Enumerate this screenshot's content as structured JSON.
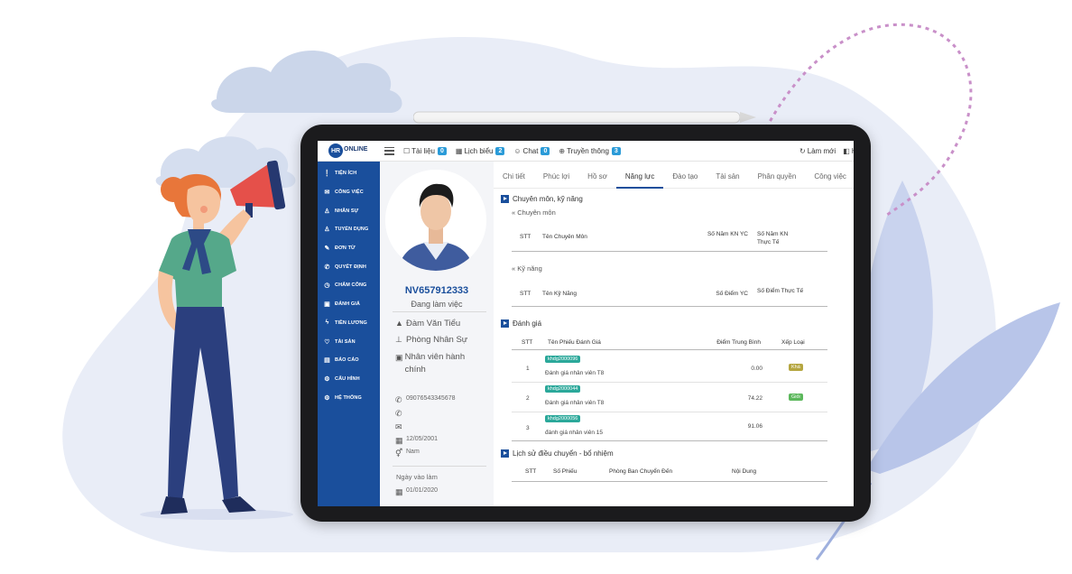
{
  "colors": {
    "primary": "#1a4f9c",
    "badge": "#2b9bd8",
    "tag": "#2ba89a",
    "grade_kha": "#b5a640",
    "grade_gioi": "#5cb85c",
    "blob": "#e9edf7"
  },
  "topbar": {
    "logo_mark": "HR",
    "logo_text": "ONLINE",
    "items": [
      {
        "icon": "task-icon",
        "label": "Tài liệu",
        "badge": "0"
      },
      {
        "icon": "calendar-icon",
        "label": "Lịch biểu",
        "badge": "2"
      },
      {
        "icon": "chat-icon",
        "label": "Chat",
        "badge": "0"
      },
      {
        "icon": "globe-icon",
        "label": "Truyền thông",
        "badge": "3"
      }
    ],
    "refresh_label": "Làm mới",
    "right_label": "Hồ"
  },
  "sidebar": {
    "items": [
      {
        "icon": "info-icon",
        "label": "TIỆN ÍCH"
      },
      {
        "icon": "briefcase-icon",
        "label": "CÔNG VIỆC"
      },
      {
        "icon": "user-icon",
        "label": "NHÂN SỰ"
      },
      {
        "icon": "user-add-icon",
        "label": "TUYỂN DỤNG"
      },
      {
        "icon": "edit-icon",
        "label": "ĐƠN TỪ"
      },
      {
        "icon": "phone-icon",
        "label": "QUYẾT ĐỊNH"
      },
      {
        "icon": "clock-icon",
        "label": "CHẤM CÔNG"
      },
      {
        "icon": "rating-icon",
        "label": "ĐÁNH GIÁ"
      },
      {
        "icon": "salary-icon",
        "label": "TIỀN LƯƠNG"
      },
      {
        "icon": "asset-icon",
        "label": "TÀI SẢN"
      },
      {
        "icon": "report-icon",
        "label": "BÁO CÁO"
      },
      {
        "icon": "config-icon",
        "label": "CẤU HÌNH"
      },
      {
        "icon": "system-icon",
        "label": "HỆ THỐNG"
      }
    ]
  },
  "profile": {
    "code": "NV657912333",
    "status": "Đang làm việc",
    "name": "Đàm Văn Tiểu",
    "department": "Phòng Nhân Sự",
    "position": "Nhân viên hành chính",
    "phone": "09076543345678",
    "birthday": "12/05/2001",
    "gender": "Nam",
    "join_label": "Ngày vào làm",
    "join_date": "01/01/2020"
  },
  "tabs": [
    "Chi tiết",
    "Phúc lợi",
    "Hồ sơ",
    "Năng lực",
    "Đào tạo",
    "Tài sản",
    "Phân quyền",
    "Công việc"
  ],
  "active_tab": "Năng lực",
  "competency": {
    "title": "Chuyên môn, kỹ năng",
    "expertise_label": "« Chuyên môn",
    "expertise_headers": [
      "STT",
      "Tên Chuyên Môn",
      "Số Năm KN YC",
      "Số Năm KN Thực Tế"
    ],
    "skill_label": "« Kỹ năng",
    "skill_headers": [
      "STT",
      "Tên Kỹ Năng",
      "Số Điểm YC",
      "Số Điểm Thực Tế"
    ]
  },
  "evaluation": {
    "title": "Đánh giá",
    "headers": [
      "STT",
      "Tên Phiếu Đánh Giá",
      "Điểm Trung Bình",
      "Xếp Loại"
    ],
    "rows": [
      {
        "stt": "1",
        "code": "khdg2000096",
        "name": "Đánh giá nhân viên T8",
        "score": "0.00",
        "grade": "Khá"
      },
      {
        "stt": "2",
        "code": "khdg2000044",
        "name": "Đánh giá nhân viên T8",
        "score": "74.22",
        "grade": "Giỏi"
      },
      {
        "stt": "3",
        "code": "khdg2000056",
        "name": "đánh giá nhân viên 15",
        "score": "91.06",
        "grade": ""
      }
    ]
  },
  "history": {
    "title": "Lịch sử điều chuyển - bổ nhiệm",
    "headers": [
      "STT",
      "Số Phiếu",
      "Phòng Ban Chuyển Đến",
      "Nội Dung"
    ]
  }
}
